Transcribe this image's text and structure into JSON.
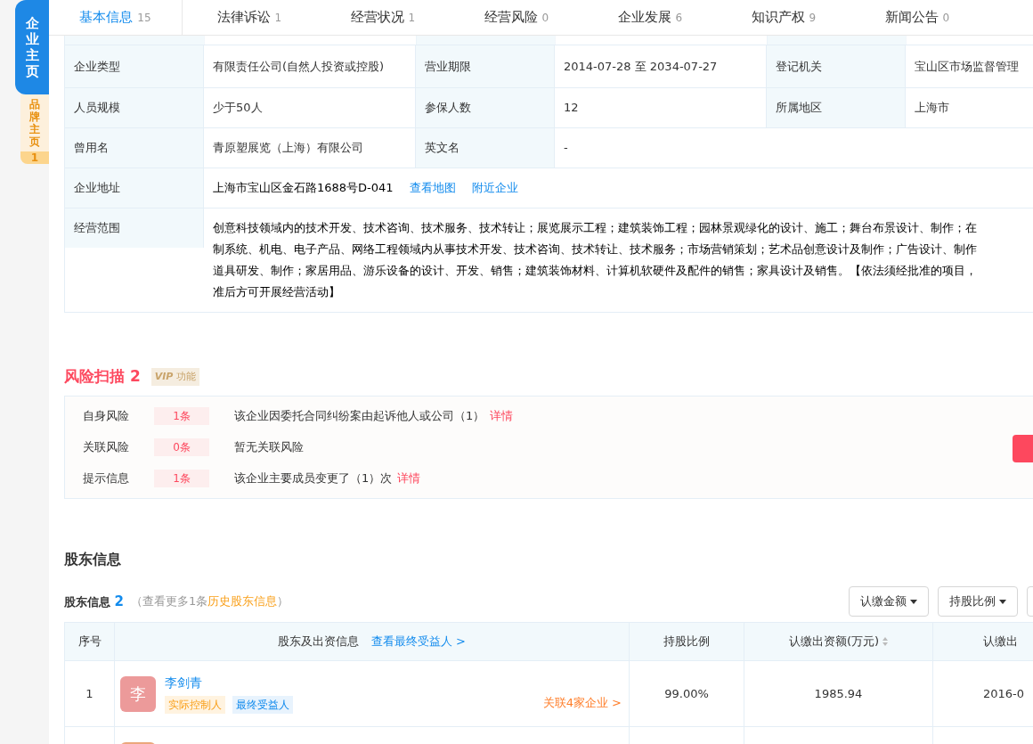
{
  "side_tabs": [
    {
      "label": "企业主页",
      "selected": true
    },
    {
      "label": "品牌主页",
      "badge": "1",
      "selected": false
    }
  ],
  "tabs": [
    {
      "label": "基本信息",
      "count": "15",
      "selected": true
    },
    {
      "label": "法律诉讼",
      "count": "1",
      "selected": false
    },
    {
      "label": "经营状况",
      "count": "1",
      "selected": false
    },
    {
      "label": "经营风险",
      "count": "0",
      "selected": false
    },
    {
      "label": "企业发展",
      "count": "6",
      "selected": false
    },
    {
      "label": "知识产权",
      "count": "9",
      "selected": false
    },
    {
      "label": "新闻公告",
      "count": "0",
      "selected": false
    }
  ],
  "info_table": {
    "rows": [
      {
        "cells": [
          {
            "kind": "label",
            "text": "企业类型"
          },
          {
            "kind": "value",
            "text": "有限责任公司(自然人投资或控股)"
          },
          {
            "kind": "label",
            "text": "营业期限"
          },
          {
            "kind": "value",
            "text": "2014-07-28 至 2034-07-27"
          },
          {
            "kind": "label",
            "text": "登记机关"
          },
          {
            "kind": "value",
            "text": "宝山区市场监督管理"
          }
        ]
      },
      {
        "cells": [
          {
            "kind": "label",
            "text": "人员规模"
          },
          {
            "kind": "value",
            "text": "少于50人"
          },
          {
            "kind": "label",
            "text": "参保人数"
          },
          {
            "kind": "value",
            "text": "12"
          },
          {
            "kind": "label",
            "text": "所属地区"
          },
          {
            "kind": "value",
            "text": "上海市"
          }
        ]
      },
      {
        "cells": [
          {
            "kind": "label",
            "text": "曾用名"
          },
          {
            "kind": "value",
            "text": "青原塑展览（上海）有限公司"
          },
          {
            "kind": "label",
            "text": "英文名"
          },
          {
            "kind": "wide",
            "text": "-"
          }
        ]
      },
      {
        "cells": [
          {
            "kind": "label",
            "text": "企业地址"
          },
          {
            "kind": "address",
            "text": "上海市宝山区金石路1688号D-041",
            "links": [
              "查看地图",
              "附近企业"
            ]
          }
        ]
      },
      {
        "cells": [
          {
            "kind": "label",
            "text": "经营范围"
          },
          {
            "kind": "scope",
            "lines": [
              "创意科技领域内的技术开发、技术咨询、技术服务、技术转让；展览展示工程；建筑装饰工程；园林景观绿化的设计、施工；舞台布景设计、制作；在",
              "制系统、机电、电子产品、网络工程领域内从事技术开发、技术咨询、技术转让、技术服务；市场营销策划；艺术品创意设计及制作；广告设计、制作",
              "道具研发、制作；家居用品、游乐设备的设计、开发、销售；建筑装饰材料、计算机软硬件及配件的销售；家具设计及销售。【依法须经批准的项目，",
              "准后方可开展经营活动】"
            ]
          }
        ]
      }
    ]
  },
  "risk": {
    "title": "风险扫描",
    "count": "2",
    "vip": "VIP",
    "vip_label": "功能",
    "rows": [
      {
        "label": "自身风险",
        "count": "1条",
        "text": "该企业因委托合同纠纷案由起诉他人或公司（1）",
        "link": "详情"
      },
      {
        "label": "关联风险",
        "count": "0条",
        "text": "暂无关联风险"
      },
      {
        "label": "提示信息",
        "count": "1条",
        "text": "该企业主要成员变更了（1）次",
        "link": "详情"
      }
    ]
  },
  "shareholders": {
    "section_title": "股东信息",
    "subtitle": "股东信息",
    "count": "2",
    "more_prefix": "（查看更多1条",
    "more_link": "历史股东信息",
    "more_suffix": "）",
    "filters": [
      "认缴金额",
      "持股比例"
    ],
    "columns": [
      {
        "label": "序号"
      },
      {
        "label": "股东及出资信息",
        "link": "查看最终受益人 >"
      },
      {
        "label": "持股比例"
      },
      {
        "label": "认缴出资额(万元)",
        "sortable": true
      },
      {
        "label": "认缴出"
      }
    ],
    "rows": [
      {
        "index": "1",
        "avatar": "李",
        "color": "#ec9a9a",
        "name": "李剑青",
        "tags": [
          {
            "text": "实际控制人",
            "color": "#fff3e0"
          },
          {
            "text": "最终受益人",
            "color": "#e8f3fd"
          }
        ],
        "related": "关联4家企业 >",
        "ratio": "99.00%",
        "amount": "1985.94",
        "date": "2016-0"
      },
      {
        "color": "#eba77c"
      }
    ]
  }
}
